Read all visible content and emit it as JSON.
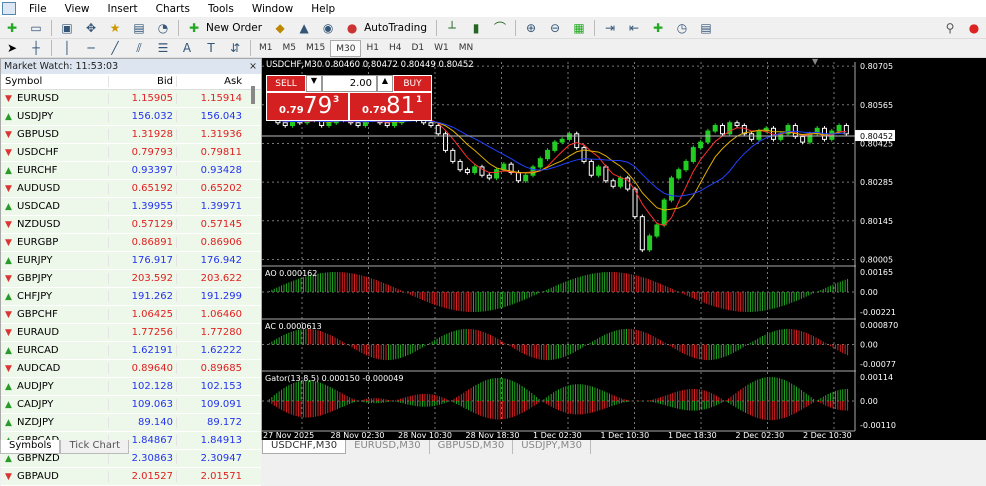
{
  "menu": [
    "File",
    "View",
    "Insert",
    "Charts",
    "Tools",
    "Window",
    "Help"
  ],
  "toolbar": {
    "new_order": "New Order",
    "autotrading": "AutoTrading",
    "timeframes": [
      "M1",
      "M5",
      "M15",
      "M30",
      "H1",
      "H4",
      "D1",
      "W1",
      "MN"
    ],
    "active_tf": "M30"
  },
  "market_watch": {
    "title": "Market Watch: 11:53:03",
    "headers": [
      "Symbol",
      "Bid",
      "Ask"
    ],
    "rows": [
      [
        "EURUSD",
        "1.15905",
        "1.15914",
        "d"
      ],
      [
        "USDJPY",
        "156.032",
        "156.043",
        "u"
      ],
      [
        "GBPUSD",
        "1.31928",
        "1.31936",
        "d"
      ],
      [
        "USDCHF",
        "0.79793",
        "0.79811",
        "d"
      ],
      [
        "EURCHF",
        "0.93397",
        "0.93428",
        "u"
      ],
      [
        "AUDUSD",
        "0.65192",
        "0.65202",
        "d"
      ],
      [
        "USDCAD",
        "1.39955",
        "1.39971",
        "u"
      ],
      [
        "NZDUSD",
        "0.57129",
        "0.57145",
        "d"
      ],
      [
        "EURGBP",
        "0.86891",
        "0.86906",
        "d"
      ],
      [
        "EURJPY",
        "176.917",
        "176.942",
        "u"
      ],
      [
        "GBPJPY",
        "203.592",
        "203.622",
        "d"
      ],
      [
        "CHFJPY",
        "191.262",
        "191.299",
        "u"
      ],
      [
        "GBPCHF",
        "1.06425",
        "1.06460",
        "d"
      ],
      [
        "EURAUD",
        "1.77256",
        "1.77280",
        "d"
      ],
      [
        "EURCAD",
        "1.62191",
        "1.62222",
        "u"
      ],
      [
        "AUDCAD",
        "0.89640",
        "0.89685",
        "d"
      ],
      [
        "AUDJPY",
        "102.128",
        "102.153",
        "u"
      ],
      [
        "CADJPY",
        "109.063",
        "109.091",
        "u"
      ],
      [
        "NZDJPY",
        "89.140",
        "89.172",
        "u"
      ],
      [
        "GBPCAD",
        "1.84867",
        "1.84913",
        "u"
      ],
      [
        "GBPNZD",
        "2.30863",
        "2.30947",
        "u"
      ],
      [
        "GBPAUD",
        "2.01527",
        "2.01571",
        "d"
      ]
    ],
    "tabs": [
      "Symbols",
      "Tick Chart"
    ]
  },
  "chart": {
    "header": "USDCHF,M30  0.80460 0.80472 0.80449 0.80452",
    "one_click": {
      "sell": "SELL",
      "buy": "BUY",
      "lot": "2.00",
      "sell_small": "0.79",
      "sell_big": "79",
      "sell_sup": "3",
      "buy_small": "0.79",
      "buy_big": "81",
      "buy_sup": "1"
    },
    "price_ticks": [
      "0.80705",
      "0.80565",
      "0.80425",
      "0.80285",
      "0.80145",
      "0.80005"
    ],
    "current_price": "0.80452",
    "price_range": [
      0.79985,
      0.8072
    ],
    "closes": [
      0.8052,
      0.805,
      0.8049,
      0.8051,
      0.805,
      0.8052,
      0.8051,
      0.8049,
      0.805,
      0.8052,
      0.8051,
      0.805,
      0.8049,
      0.8051,
      0.8052,
      0.805,
      0.8049,
      0.805,
      0.8052,
      0.8053,
      0.8051,
      0.805,
      0.8049,
      0.8046,
      0.804,
      0.8036,
      0.8033,
      0.8032,
      0.8034,
      0.8031,
      0.803,
      0.8033,
      0.8035,
      0.8032,
      0.8029,
      0.8031,
      0.8034,
      0.8037,
      0.804,
      0.8043,
      0.8044,
      0.8046,
      0.8041,
      0.8036,
      0.8031,
      0.8034,
      0.8029,
      0.8027,
      0.803,
      0.8026,
      0.8016,
      0.8004,
      0.8009,
      0.8013,
      0.8022,
      0.803,
      0.8033,
      0.8036,
      0.8041,
      0.8043,
      0.8047,
      0.8049,
      0.8046,
      0.805,
      0.8049,
      0.8046,
      0.8044,
      0.8047,
      0.8048,
      0.8044,
      0.8046,
      0.8049,
      0.8045,
      0.8043,
      0.8046,
      0.8048,
      0.8044,
      0.8047,
      0.8049,
      0.8046
    ],
    "ao": {
      "label": "AO 0.000162",
      "ticks": [
        "0.00165",
        "0.00",
        "-0.00221"
      ]
    },
    "ac": {
      "label": "AC 0.0000613",
      "ticks": [
        "0.000870",
        "0.00",
        "-0.00077"
      ]
    },
    "gator": {
      "label": "Gator(13,8,5) 0.000150 -0.000049",
      "ticks": [
        "0.00114",
        "0.00",
        "-0.00110"
      ]
    },
    "time_labels": [
      "27 Nov 2025",
      "28 Nov 02:30",
      "28 Nov 10:30",
      "28 Nov 18:30",
      "1 Dec 02:30",
      "1 Dec 10:30",
      "1 Dec 18:30",
      "2 Dec 02:30",
      "2 Dec 10:30"
    ],
    "tabs": [
      "USDCHF,M30",
      "EURUSD,M30",
      "GBPUSD,M30",
      "USDJPY,M30"
    ],
    "colors": {
      "bull": "#22cc22",
      "bear": "#ffffff",
      "ma1": "#ff3030",
      "ma2": "#2040ff",
      "ma3": "#e0b000",
      "ao_up": "#22aa22",
      "ao_dn": "#dd2222"
    }
  }
}
